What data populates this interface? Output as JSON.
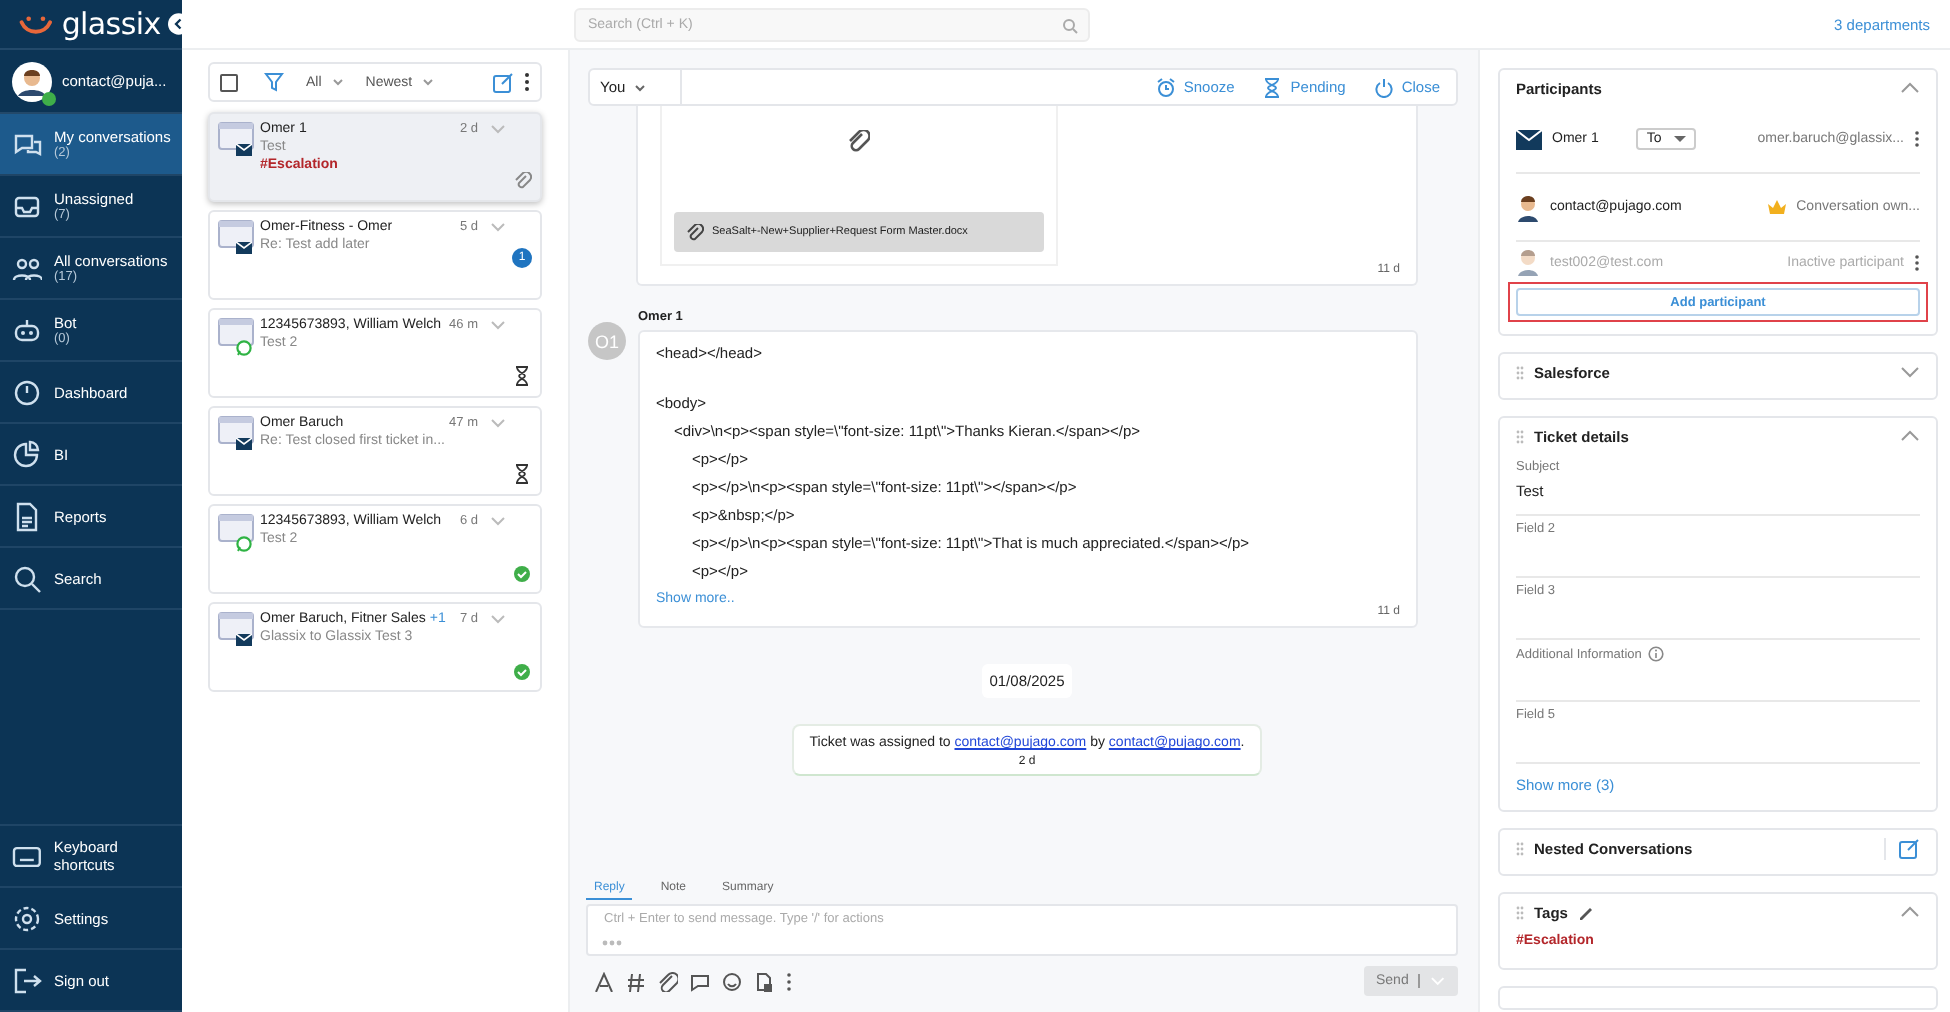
{
  "app": {
    "logo": "glassix",
    "departments": "3 departments"
  },
  "user": {
    "email": "contact@puja...",
    "online": true
  },
  "sidebar": {
    "items": [
      {
        "label": "My conversations",
        "count": "(2)",
        "selected": true
      },
      {
        "label": "Unassigned",
        "count": "(7)",
        "selected": false
      },
      {
        "label": "All conversations",
        "count": "(17)",
        "selected": false
      },
      {
        "label": "Bot",
        "count": "(0)",
        "selected": false
      },
      {
        "label": "Dashboard",
        "selected": false
      },
      {
        "label": "BI",
        "selected": false
      },
      {
        "label": "Reports",
        "selected": false
      },
      {
        "label": "Search",
        "selected": false
      }
    ],
    "bottom_items": [
      {
        "label": "Keyboard shortcuts"
      },
      {
        "label": "Settings"
      },
      {
        "label": "Sign out"
      }
    ]
  },
  "list_toolbar": {
    "select_all": {
      "checked": false
    },
    "filter": "All",
    "sort": "Newest"
  },
  "conversations": [
    {
      "name": "Omer 1",
      "time": "2 d",
      "channel": {
        "kind": "email"
      },
      "preview": "Test",
      "tag": "#Escalation",
      "status": {
        "kind": "attachment"
      },
      "selected": true
    },
    {
      "name": "Omer-Fitness - Omer",
      "time": "5 d",
      "channel": {
        "kind": "email"
      },
      "preview": "Re: Test add later",
      "status": {
        "kind": "unread",
        "count": "1"
      },
      "selected": false
    },
    {
      "name": "12345673893, William Welch",
      "time": "46 m",
      "channel": {
        "kind": "whatsapp"
      },
      "preview": "Test 2",
      "status": {
        "kind": "pending"
      },
      "selected": false
    },
    {
      "name": "Omer Baruch",
      "time": "47 m",
      "channel": {
        "kind": "email"
      },
      "preview": "Re: Test closed first ticket in...",
      "status": {
        "kind": "pending"
      },
      "selected": false
    },
    {
      "name": "12345673893, William Welch",
      "time": "6 d",
      "channel": {
        "kind": "whatsapp"
      },
      "preview": "Test 2",
      "status": {
        "kind": "done"
      },
      "selected": false
    },
    {
      "name": "Omer Baruch, Fitner Sales",
      "extra": "+1",
      "time": "7 d",
      "channel": {
        "kind": "email"
      },
      "preview": "Glassix to Glassix Test 3",
      "status": {
        "kind": "done"
      },
      "selected": false
    }
  ],
  "search": {
    "placeholder": "Search (Ctrl + K)"
  },
  "conversation_toolbar": {
    "assignee": "You",
    "actions": [
      "Snooze",
      "Pending",
      "Close"
    ]
  },
  "messages": [
    {
      "kind": "attachment",
      "file": "SeaSalt+-New+Supplier+Request Form Master.docx",
      "time": "11 d"
    },
    {
      "kind": "text",
      "avatar": "O1",
      "sender": "Omer 1",
      "lines": [
        {
          "text": "<head></head>"
        },
        {
          "text": "<body>",
          "space_before": true,
          "children": [
            {
              "text": "<div>\\n<p><span style=\\\"font-size: 11pt\\\">Thanks Kieran.</span></p>",
              "children": [
                {
                  "text": "<p></p>"
                },
                {
                  "text": "<p></p>\\n<p><span style=\\\"font-size: 11pt\\\"></span></p>"
                },
                {
                  "text": "<p>&nbsp;</p>"
                },
                {
                  "text": "<p></p>\\n<p><span style=\\\"font-size: 11pt\\\">That is much appreciated.</span></p>"
                },
                {
                  "text": "<p></p>"
                }
              ]
            }
          ]
        }
      ],
      "more": "Show more..",
      "time": "11 d"
    },
    {
      "kind": "date",
      "text": "01/08/2025"
    },
    {
      "kind": "system",
      "parts": [
        {
          "text": "Ticket was assigned to "
        },
        {
          "link": "contact@pujago.com"
        },
        {
          "text": " by "
        },
        {
          "link": "contact@pujago.com"
        },
        {
          "text": "."
        }
      ],
      "time": "2 d"
    }
  ],
  "composer": {
    "tabs": [
      {
        "label": "Reply",
        "selected": true
      },
      {
        "label": "Note",
        "selected": false
      },
      {
        "label": "Summary",
        "selected": false
      }
    ],
    "placeholder": "Ctrl + Enter to send message. Type '/' for actions",
    "send": {
      "label": "Send",
      "disabled": true
    }
  },
  "participants": {
    "title": "Participants",
    "expanded": true,
    "items": [
      {
        "kind": "email",
        "name": "Omer 1",
        "role": "To",
        "address": "omer.baruch@glassix...",
        "active": true
      },
      {
        "kind": "agent",
        "name": "contact@pujago.com",
        "note": "Conversation own...",
        "owner": true,
        "active": true
      },
      {
        "kind": "agent",
        "name": "test002@test.com",
        "note": "Inactive participant",
        "owner": false,
        "active": false
      }
    ],
    "add_button": {
      "label": "Add participant",
      "highlighted": true
    }
  },
  "salesforce": {
    "title": "Salesforce",
    "expanded": false
  },
  "ticket_details": {
    "title": "Ticket details",
    "expanded": true,
    "fields": [
      {
        "label": "Subject",
        "value": "Test"
      },
      {
        "label": "Field 2"
      },
      {
        "label": "Field 3"
      },
      {
        "label": "Additional Information",
        "info": true
      },
      {
        "label": "Field 5"
      }
    ],
    "show_more": "Show more (3)"
  },
  "nested_conversations": {
    "title": "Nested Conversations"
  },
  "tags": {
    "title": "Tags",
    "expanded": true,
    "items": [
      "#Escalation"
    ]
  }
}
